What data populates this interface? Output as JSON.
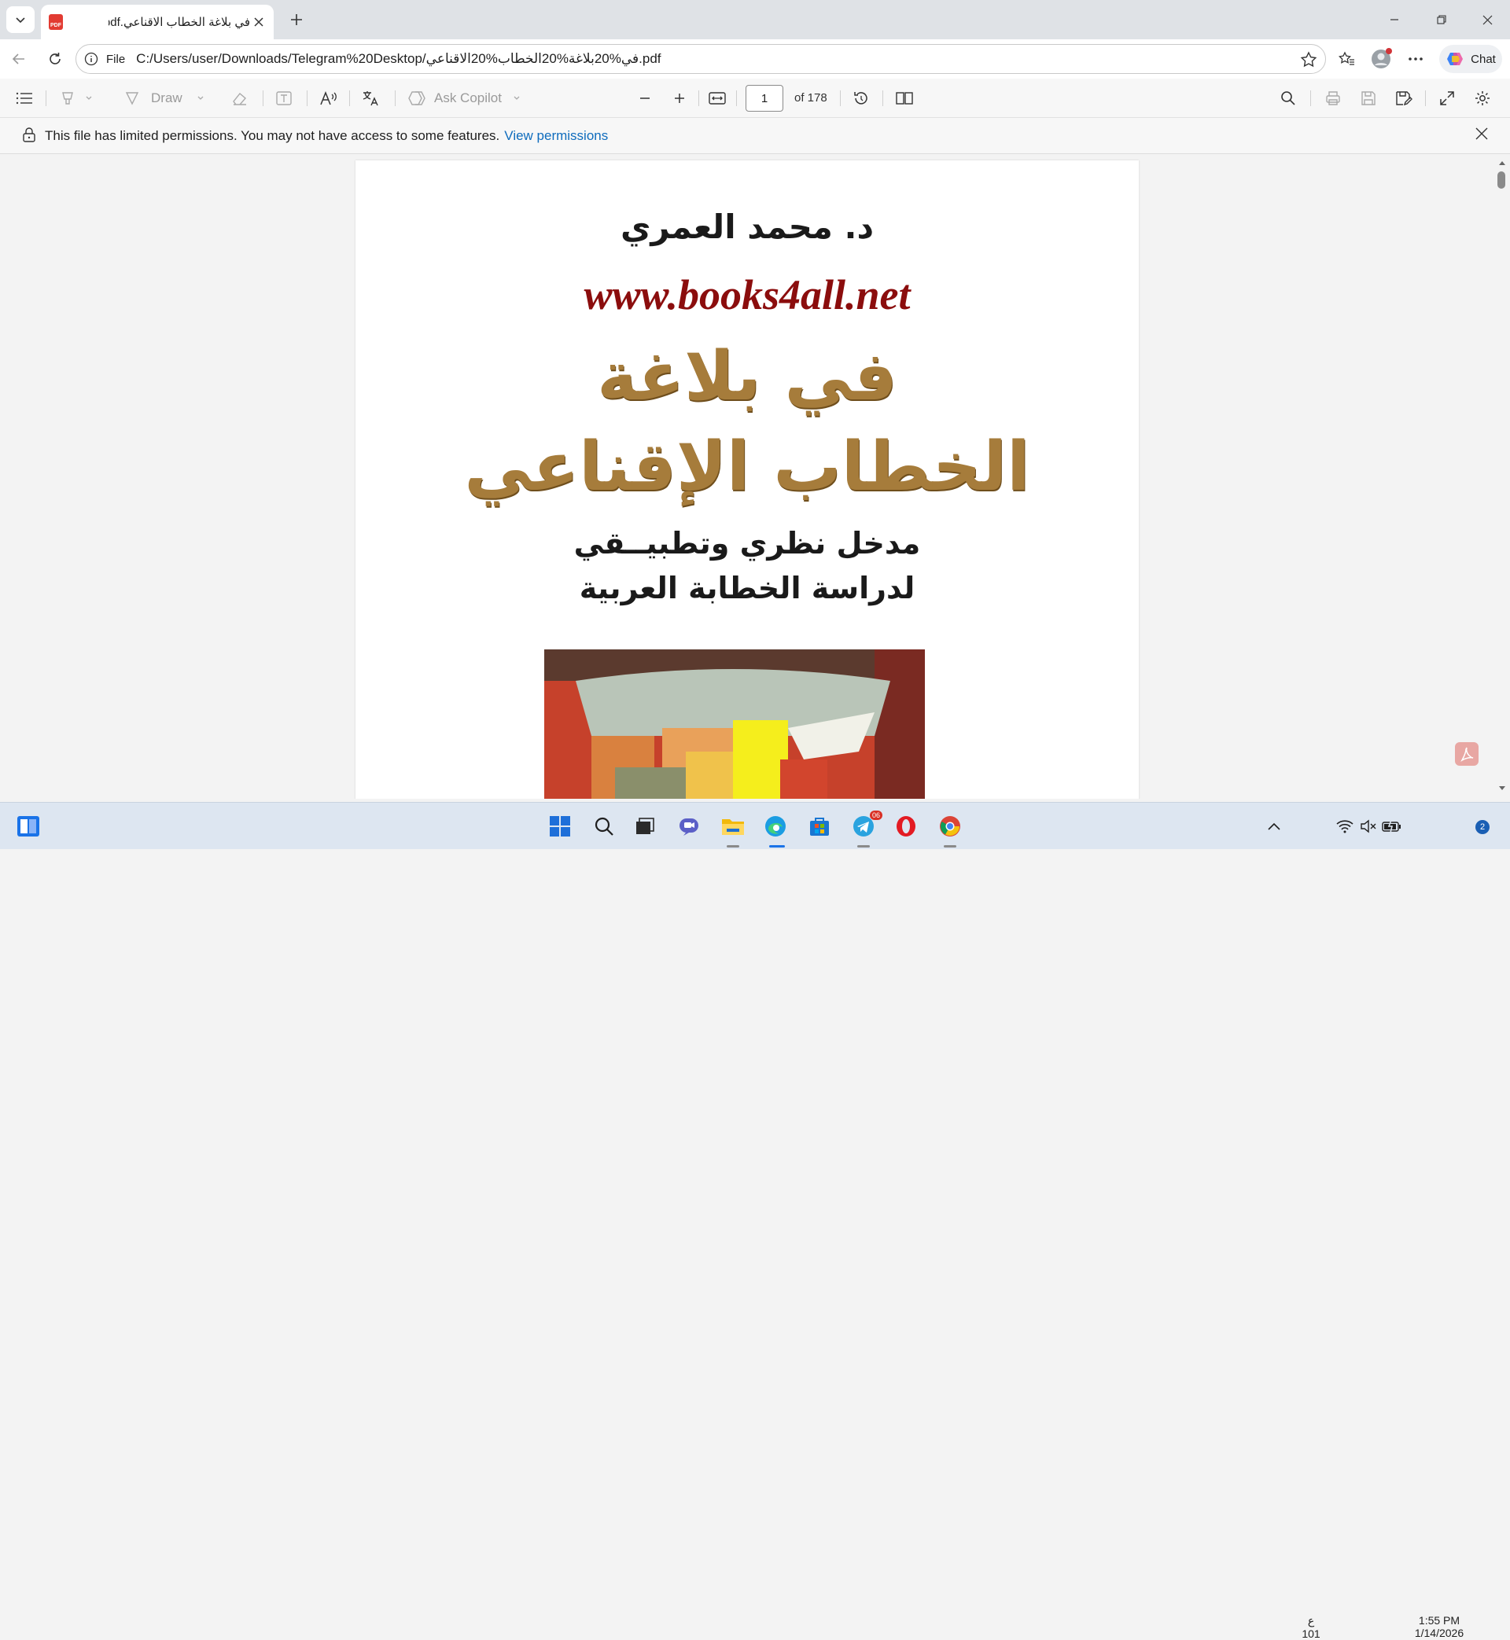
{
  "browser": {
    "tab": {
      "title": "في بلاغة الخطاب الاقناعي.pdf",
      "favicon_label": "PDF"
    },
    "address": {
      "scheme_label": "File",
      "url": "C:/Users/user/Downloads/Telegram%20Desktop/في%20بلاغة%20الخطاب%20الاقناعي.pdf"
    },
    "chat_label": "Chat"
  },
  "pdf_toolbar": {
    "draw_label": "Draw",
    "ask_copilot_label": "Ask Copilot",
    "current_page": "1",
    "page_count_label": "of 178"
  },
  "infobar": {
    "message": "This file has limited permissions. You may not have access to some features.",
    "link": "View permissions"
  },
  "document": {
    "author": "د. محمد العمري",
    "watermark": "www.books4all.net",
    "title_line1": "في بلاغة",
    "title_line2": "الخطاب الإقناعي",
    "subtitle_line1": "مدخل نظري وتطبيــقي",
    "subtitle_line2": "لدراسة الخطابة العربية"
  },
  "taskbar": {
    "telegram_badge": "06",
    "keyboard_lang": "ع",
    "keyboard_sub": "101",
    "time": "1:55 PM",
    "date": "1/14/2026",
    "notifications": "2"
  },
  "colors": {
    "accent_link": "#0f6cbd",
    "title_gold": "#a67c3b",
    "watermark_red": "#8b0d0d"
  }
}
